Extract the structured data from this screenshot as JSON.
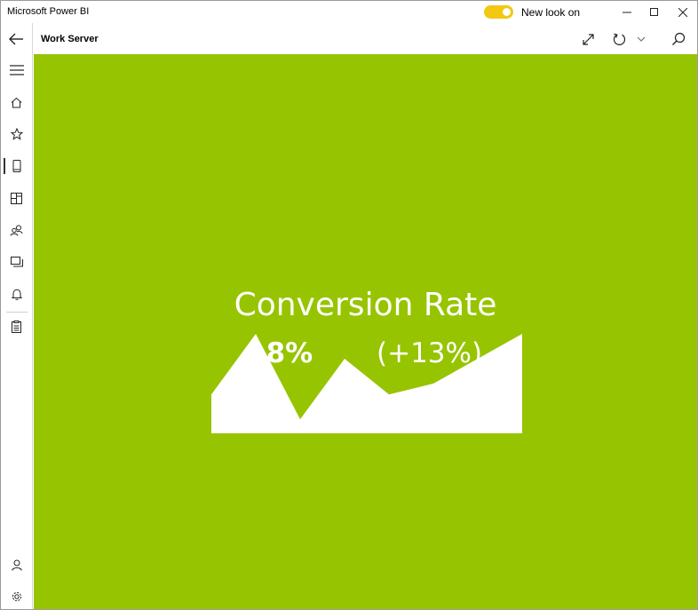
{
  "window": {
    "app_title": "Microsoft Power BI"
  },
  "titlebar": {
    "toggle_label": "New look on",
    "toggle_on": true,
    "toggle_color": "#f2c811",
    "buttons": [
      {
        "icon": "minimize-icon"
      },
      {
        "icon": "maximize-icon"
      },
      {
        "icon": "close-icon"
      }
    ]
  },
  "header": {
    "page_title": "Work Server",
    "buttons": [
      {
        "icon": "expand-icon"
      },
      {
        "icon": "refresh-icon"
      },
      {
        "icon": "chevron-down-icon"
      },
      {
        "icon": "search-icon"
      }
    ]
  },
  "sidebar": {
    "items": [
      {
        "icon": "back-arrow-icon"
      },
      {
        "icon": "hamburger-menu-icon"
      },
      {
        "icon": "home-icon"
      },
      {
        "icon": "star-icon"
      },
      {
        "icon": "device-icon",
        "active": true
      },
      {
        "icon": "dashboards-icon"
      },
      {
        "icon": "shared-icon"
      },
      {
        "icon": "apps-icon"
      },
      {
        "icon": "bell-icon"
      },
      {
        "icon": "clipboard-icon"
      },
      {
        "icon": "user-icon"
      },
      {
        "icon": "settings-gear-icon"
      }
    ]
  },
  "tile": {
    "background_color": "#97c400",
    "title": "Conversion Rate",
    "value": "18%",
    "change": "(+13%)"
  },
  "chart_data": {
    "type": "area",
    "title": "Conversion Rate",
    "xlabel": "",
    "ylabel": "",
    "grid": false,
    "x": [
      0,
      1,
      2,
      3,
      4,
      5,
      6,
      7
    ],
    "values": [
      0.39,
      1.0,
      0.14,
      0.75,
      0.39,
      0.5,
      0.75,
      1.0
    ],
    "ylim": [
      0,
      1
    ]
  }
}
